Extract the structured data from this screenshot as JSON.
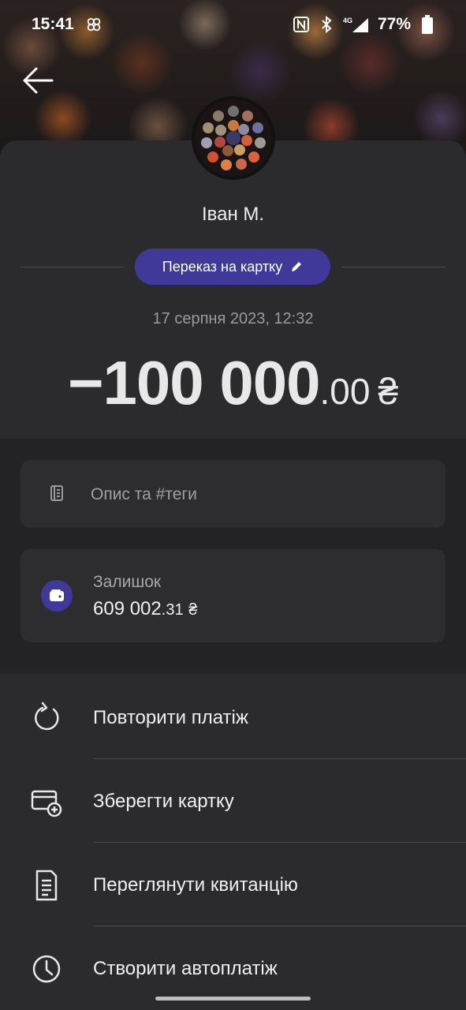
{
  "status_bar": {
    "time": "15:41",
    "network_label": "4G",
    "battery": "77%"
  },
  "header": {
    "back_icon": "arrow-left-icon",
    "recipient_name": "Іван М."
  },
  "transaction": {
    "category": "Переказ на картку",
    "datetime": "17 серпня 2023, 12:32",
    "amount_int": "−100 000",
    "amount_dec": ".00",
    "currency": "₴"
  },
  "description": {
    "placeholder": "Опис та #теги"
  },
  "balance": {
    "label": "Залишок",
    "value_int": "609 002",
    "value_dec": ".31",
    "currency": "₴"
  },
  "actions": [
    {
      "label": "Повторити платіж",
      "icon": "repeat-icon"
    },
    {
      "label": "Зберегти картку",
      "icon": "add-card-icon"
    },
    {
      "label": "Переглянути квитанцію",
      "icon": "receipt-icon"
    },
    {
      "label": "Створити автоплатіж",
      "icon": "clock-icon"
    }
  ],
  "colors": {
    "accent": "#3f3a9a",
    "sheet": "#2b2b2d",
    "card": "#2d2d30"
  }
}
